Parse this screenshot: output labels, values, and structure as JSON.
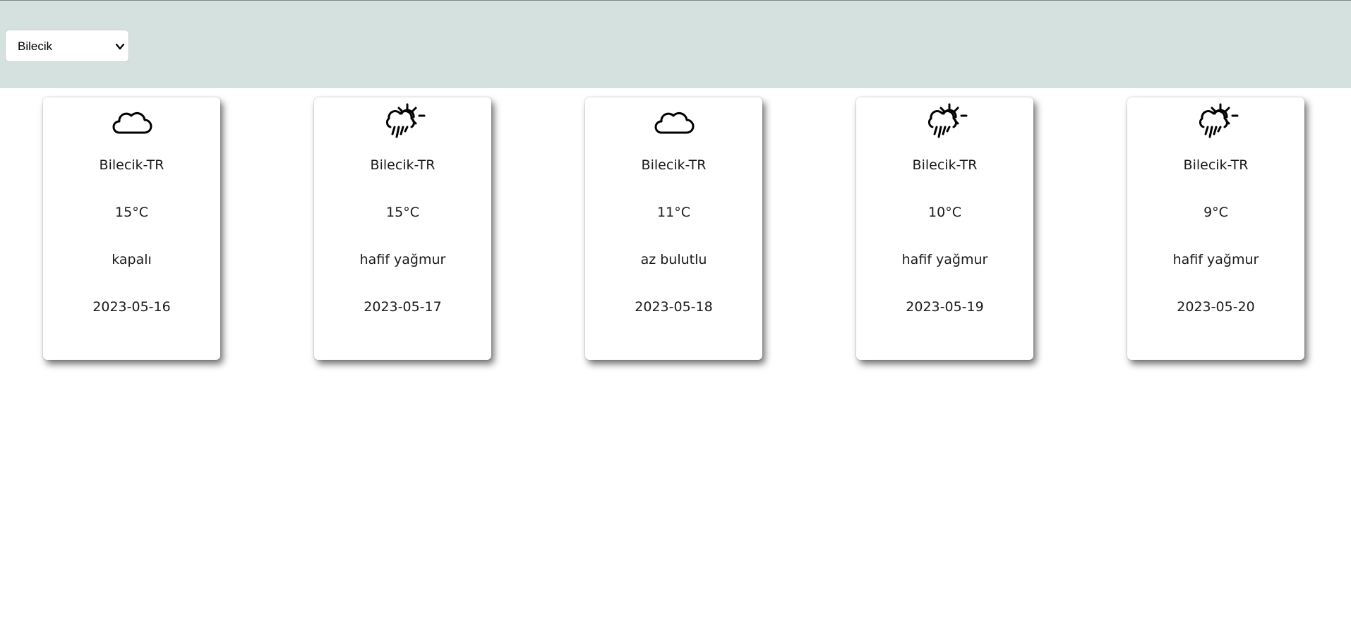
{
  "city_select": {
    "value": "Bilecik",
    "icon": "chevron-down-icon"
  },
  "forecast": [
    {
      "icon": "cloud-icon",
      "location": "Bilecik-TR",
      "temperature": "15°C",
      "description": "kapalı",
      "date": "2023-05-16"
    },
    {
      "icon": "sun-rain-icon",
      "location": "Bilecik-TR",
      "temperature": "15°C",
      "description": "hafif yağmur",
      "date": "2023-05-17"
    },
    {
      "icon": "cloud-icon",
      "location": "Bilecik-TR",
      "temperature": "11°C",
      "description": "az bulutlu",
      "date": "2023-05-18"
    },
    {
      "icon": "sun-rain-icon",
      "location": "Bilecik-TR",
      "temperature": "10°C",
      "description": "hafif yağmur",
      "date": "2023-05-19"
    },
    {
      "icon": "sun-rain-icon",
      "location": "Bilecik-TR",
      "temperature": "9°C",
      "description": "hafif yağmur",
      "date": "2023-05-20"
    }
  ],
  "colors": {
    "header_bg": "#d4e1df",
    "card_bg": "#ffffff"
  }
}
